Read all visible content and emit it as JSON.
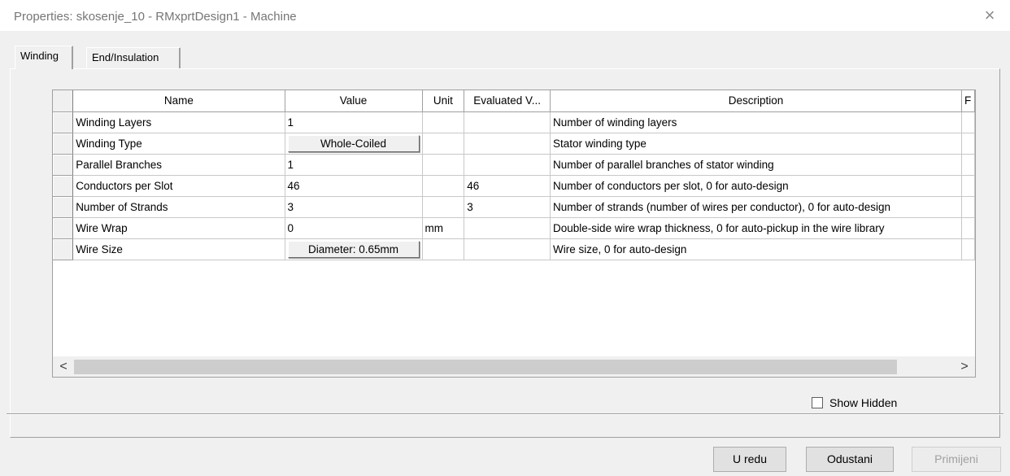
{
  "window": {
    "title": "Properties: skosenje_10 - RMxprtDesign1 - Machine",
    "close_glyph": "×"
  },
  "tabs": [
    {
      "label": "Winding",
      "active": true
    },
    {
      "label": "End/Insulation",
      "active": false
    }
  ],
  "table": {
    "columns": [
      "Name",
      "Value",
      "Unit",
      "Evaluated V...",
      "Description",
      "F"
    ],
    "rows": [
      {
        "name": "Winding Layers",
        "value": "1",
        "value_is_button": false,
        "unit": "",
        "evaluated": "",
        "description": "Number of winding layers"
      },
      {
        "name": "Winding Type",
        "value": "Whole-Coiled",
        "value_is_button": true,
        "unit": "",
        "evaluated": "",
        "description": "Stator winding type"
      },
      {
        "name": "Parallel Branches",
        "value": "1",
        "value_is_button": false,
        "unit": "",
        "evaluated": "",
        "description": "Number of parallel branches of stator winding"
      },
      {
        "name": "Conductors per Slot",
        "value": "46",
        "value_is_button": false,
        "unit": "",
        "evaluated": "46",
        "description": "Number of conductors per slot, 0 for auto-design"
      },
      {
        "name": "Number of Strands",
        "value": "3",
        "value_is_button": false,
        "unit": "",
        "evaluated": "3",
        "description": "Number of strands (number of wires per conductor), 0 for auto-design"
      },
      {
        "name": "Wire Wrap",
        "value": "0",
        "value_is_button": false,
        "unit": "mm",
        "evaluated": "",
        "description": "Double-side wire wrap thickness, 0 for auto-pickup in the wire library"
      },
      {
        "name": "Wire Size",
        "value": "Diameter: 0.65mm",
        "value_is_button": true,
        "unit": "",
        "evaluated": "",
        "description": "Wire size, 0 for auto-design"
      }
    ]
  },
  "scrollbar": {
    "left_glyph": "<",
    "right_glyph": ">"
  },
  "show_hidden": {
    "label": "Show Hidden",
    "checked": false
  },
  "buttons": {
    "ok": "U redu",
    "cancel": "Odustani",
    "apply": "Primijeni"
  }
}
